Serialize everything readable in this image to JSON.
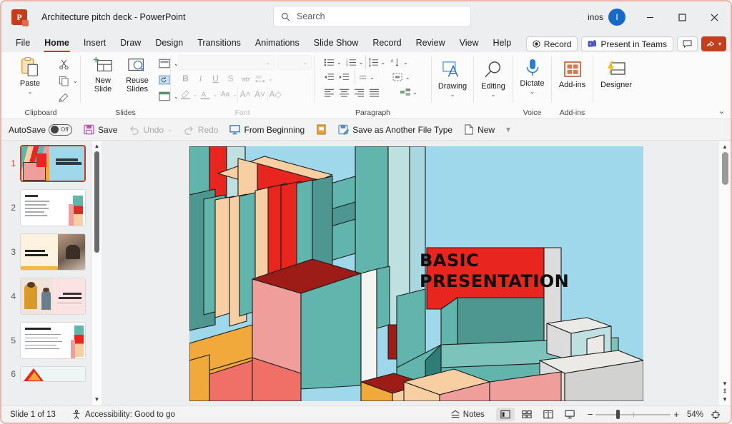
{
  "titlebar": {
    "app_icon": "powerpoint-logo",
    "logo_letter": "P",
    "document_title": "Architecture pitch deck  -  PowerPoint",
    "search_placeholder": "Search",
    "search_icon": "search-icon",
    "account_name": "inos",
    "avatar_initial": "I",
    "minimize": "minimize-icon",
    "maximize": "maximize-icon",
    "close": "close-icon"
  },
  "ribbon_tabs": {
    "items": [
      {
        "label": "File",
        "active": false
      },
      {
        "label": "Home",
        "active": true
      },
      {
        "label": "Insert",
        "active": false
      },
      {
        "label": "Draw",
        "active": false
      },
      {
        "label": "Design",
        "active": false
      },
      {
        "label": "Transitions",
        "active": false
      },
      {
        "label": "Animations",
        "active": false
      },
      {
        "label": "Slide Show",
        "active": false
      },
      {
        "label": "Record",
        "active": false
      },
      {
        "label": "Review",
        "active": false
      },
      {
        "label": "View",
        "active": false
      },
      {
        "label": "Help",
        "active": false
      }
    ],
    "right_buttons": [
      {
        "label": "Record",
        "icon": "record-dot-icon"
      },
      {
        "label": "Present in Teams",
        "icon": "teams-icon"
      },
      {
        "label": "",
        "icon": "comments-icon"
      },
      {
        "label": "",
        "icon": "share-icon"
      }
    ]
  },
  "ribbon": {
    "groups": [
      {
        "name": "Clipboard",
        "label": "Clipboard",
        "has_dialog_launcher": true,
        "items": [
          {
            "label": "Paste",
            "icon": "paste-icon",
            "has_dropdown": true
          },
          {
            "label": "",
            "icon": "cut-scissors-icon"
          },
          {
            "label": "",
            "icon": "copy-icon",
            "has_dropdown": true
          },
          {
            "label": "",
            "icon": "format-painter-icon"
          }
        ]
      },
      {
        "name": "Slides",
        "label": "Slides",
        "has_dialog_launcher": false,
        "items": [
          {
            "label": "New Slide",
            "icon": "new-slide-icon",
            "has_dropdown": true
          },
          {
            "label": "Reuse Slides",
            "icon": "reuse-slides-icon"
          },
          {
            "label": "",
            "icon": "layout-icon",
            "has_dropdown": true
          },
          {
            "label": "",
            "icon": "reset-icon"
          },
          {
            "label": "",
            "icon": "section-icon",
            "has_dropdown": true
          }
        ]
      },
      {
        "name": "Font",
        "label": "Font",
        "disabled": true,
        "has_dialog_launcher": true,
        "font_name_value": "",
        "font_size_value": "",
        "items": [
          {
            "label": "",
            "icon": "bold-icon"
          },
          {
            "label": "",
            "icon": "italic-icon"
          },
          {
            "label": "",
            "icon": "underline-icon"
          },
          {
            "label": "",
            "icon": "text-shadow-icon"
          },
          {
            "label": "",
            "icon": "strikethrough-icon"
          },
          {
            "label": "",
            "icon": "character-spacing-icon",
            "has_dropdown": true
          },
          {
            "label": "",
            "icon": "text-highlight-color-icon",
            "has_dropdown": true
          },
          {
            "label": "",
            "icon": "font-color-icon",
            "has_dropdown": true
          },
          {
            "label": "",
            "icon": "change-case-icon",
            "has_dropdown": true
          },
          {
            "label": "",
            "icon": "increase-font-size-icon"
          },
          {
            "label": "",
            "icon": "decrease-font-size-icon"
          },
          {
            "label": "",
            "icon": "clear-formatting-icon"
          }
        ]
      },
      {
        "name": "Paragraph",
        "label": "Paragraph",
        "has_dialog_launcher": true,
        "items": [
          {
            "label": "",
            "icon": "bullets-icon",
            "has_dropdown": true
          },
          {
            "label": "",
            "icon": "numbering-icon",
            "has_dropdown": true
          },
          {
            "label": "",
            "icon": "line-spacing-icon",
            "has_dropdown": true
          },
          {
            "label": "",
            "icon": "text-direction-icon",
            "has_dropdown": true
          },
          {
            "label": "",
            "icon": "decrease-indent-icon"
          },
          {
            "label": "",
            "icon": "increase-indent-icon"
          },
          {
            "label": "",
            "icon": "paragraph-spacing-icon",
            "has_dropdown": true
          },
          {
            "label": "",
            "icon": "align-text-icon",
            "has_dropdown": true
          },
          {
            "label": "",
            "icon": "align-left-icon"
          },
          {
            "label": "",
            "icon": "align-center-icon"
          },
          {
            "label": "",
            "icon": "align-right-icon"
          },
          {
            "label": "",
            "icon": "justify-icon"
          },
          {
            "label": "",
            "icon": "convert-to-smartart-icon",
            "has_dropdown": true
          }
        ]
      },
      {
        "name": "Drawing",
        "label": "",
        "items": [
          {
            "label": "Drawing",
            "icon": "drawing-shapes-icon",
            "has_dropdown": true
          }
        ]
      },
      {
        "name": "Editing",
        "label": "",
        "items": [
          {
            "label": "Editing",
            "icon": "editing-magnifier-icon",
            "has_dropdown": true
          }
        ]
      },
      {
        "name": "Voice",
        "label": "Voice",
        "items": [
          {
            "label": "Dictate",
            "icon": "microphone-icon",
            "has_dropdown": true
          }
        ]
      },
      {
        "name": "Add-ins",
        "label": "Add-ins",
        "items": [
          {
            "label": "Add-ins",
            "icon": "addins-grid-icon"
          }
        ]
      },
      {
        "name": "Designer",
        "label": "",
        "items": [
          {
            "label": "Designer",
            "icon": "designer-icon"
          }
        ]
      }
    ],
    "collapse_icon": "chevron-down-icon"
  },
  "quick_access": {
    "autosave_label": "AutoSave",
    "autosave_state": "Off",
    "items": [
      {
        "label": "Save",
        "icon": "save-disk-icon",
        "disabled": false
      },
      {
        "label": "Undo",
        "icon": "undo-arrow-icon",
        "disabled": true,
        "has_dropdown": true
      },
      {
        "label": "Redo",
        "icon": "redo-arrow-icon",
        "disabled": true
      },
      {
        "label": "From Beginning",
        "icon": "from-beginning-icon",
        "disabled": false
      },
      {
        "label": "",
        "icon": "present-online-icon",
        "disabled": false
      },
      {
        "label": "Save as Another File Type",
        "icon": "save-as-icon",
        "disabled": false
      },
      {
        "label": "New",
        "icon": "new-file-icon",
        "disabled": false
      }
    ],
    "overflow_icon": "customize-qat-icon"
  },
  "slide_panel": {
    "thumbnails": [
      {
        "number": "1",
        "selected": true,
        "style": "cover"
      },
      {
        "number": "2",
        "selected": false,
        "style": "agenda"
      },
      {
        "number": "3",
        "selected": false,
        "style": "photo-left"
      },
      {
        "number": "4",
        "selected": false,
        "style": "photo-pink"
      },
      {
        "number": "5",
        "selected": false,
        "style": "bullets"
      },
      {
        "number": "6",
        "selected": false,
        "style": "partial"
      }
    ],
    "scroll_up_icon": "scroll-up-arrow",
    "scroll_down_icon": "scroll-down-arrow"
  },
  "slide": {
    "title_line1": "BASIC",
    "title_line2": "PRESENTATION",
    "background_color": "#9ed8ea",
    "artwork_name": "isometric-architecture-illustration",
    "palette": {
      "sky": "#9ed8ea",
      "red": "#e8251f",
      "dark_red": "#9e1c17",
      "teal": "#62b5ac",
      "dark_teal": "#4e9790",
      "deep_teal": "#2e7d78",
      "peach": "#f7cfa3",
      "pink": "#ef9e9b",
      "salmon": "#f07068",
      "orange": "#f2a93b",
      "light_gray": "#dcdcdc",
      "pale_teal": "#bfe0e0",
      "white": "#ffffff",
      "outline": "#1b1b1b"
    }
  },
  "right_scroll": {
    "up_icon": "scroll-up-arrow",
    "previous_slide_icon": "previous-slide-arrow",
    "slide_icon": "back-to-slide-icon",
    "next_slide_icon": "next-slide-arrow"
  },
  "status_bar": {
    "slide_counter": "Slide 1 of 13",
    "accessibility_icon": "accessibility-icon",
    "accessibility_text": "Accessibility: Good to go",
    "notes_label": "Notes",
    "notes_icon": "notes-icon",
    "views": [
      {
        "name": "normal-view",
        "icon": "normal-view-icon",
        "active": true
      },
      {
        "name": "slide-sorter-view",
        "icon": "slide-sorter-icon",
        "active": false
      },
      {
        "name": "reading-view",
        "icon": "reading-view-icon",
        "active": false
      },
      {
        "name": "slide-show-view",
        "icon": "slide-show-icon",
        "active": false
      }
    ],
    "zoom_out_label": "−",
    "zoom_in_label": "+",
    "zoom_value": "54%",
    "fit_icon": "fit-to-window-icon"
  }
}
